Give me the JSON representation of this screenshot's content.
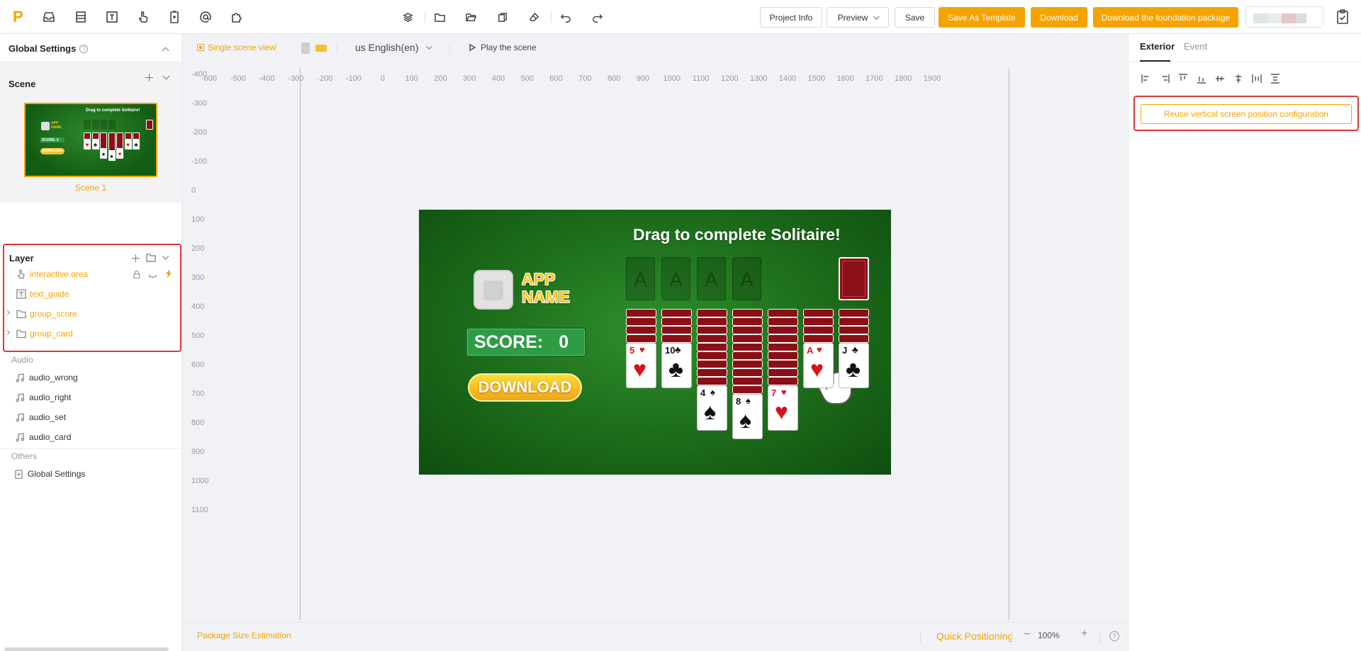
{
  "toolbar": {
    "left_icons": [
      "inbox-icon",
      "layout-icon",
      "text-icon",
      "hand-pointer-icon",
      "battery-icon",
      "at-sign-icon",
      "puzzle-icon"
    ],
    "project_info": "Project Info",
    "preview": "Preview",
    "save": "Save",
    "save_template": "Save As Template",
    "download": "Download",
    "download_foundation": "Download the foundation package",
    "accent": "#f5a300"
  },
  "left_panel": {
    "global_settings": "Global Settings",
    "help_mark": "?",
    "scene_title": "Scene",
    "scene_label": "Scene 1",
    "layer_title": "Layer",
    "layers": [
      {
        "label": "interactive area",
        "icon": "hand-pointer-icon"
      },
      {
        "label": "text_guide",
        "icon": "text-icon"
      },
      {
        "label": "group_score",
        "icon": "folder-icon"
      },
      {
        "label": "group_card",
        "icon": "folder-icon"
      }
    ],
    "audio_title": "Audio",
    "audio": [
      "audio_wrong",
      "audio_right",
      "audio_set",
      "audio_card"
    ],
    "others_title": "Others",
    "others": [
      "Global Settings"
    ]
  },
  "canvas": {
    "single_scene": "Single scene view",
    "language": "us English(en)",
    "play_scene": "Play the scene",
    "ruler_h": [
      "-600",
      "-500",
      "-400",
      "-300",
      "-200",
      "-100",
      "0",
      "100",
      "200",
      "300",
      "400",
      "500",
      "600",
      "700",
      "800",
      "900",
      "1000",
      "1100",
      "1200",
      "1300",
      "1400",
      "1500",
      "1600",
      "1700",
      "1800",
      "1900"
    ],
    "ruler_v": [
      "-400",
      "-300",
      "-200",
      "-100",
      "0",
      "100",
      "200",
      "300",
      "400",
      "500",
      "600",
      "700",
      "800",
      "900",
      "1000",
      "1100"
    ],
    "package_size": "Package Size Estimation",
    "quick_positioning": "Quick Positioning",
    "zoom": "100%",
    "zoom_minus": "−",
    "zoom_plus": "+",
    "help_mark": "?"
  },
  "stage": {
    "title": "Drag to complete Solitaire!",
    "app_name_1": "APP",
    "app_name_2": "NAME",
    "score_label": "SCORE:",
    "score_value": "0",
    "download": "DOWNLOAD",
    "foundation_letter": "A",
    "columns": [
      {
        "rank": "5",
        "suit": "♥",
        "color": "red",
        "backs": 4
      },
      {
        "rank": "10",
        "suit": "♣",
        "color": "blk",
        "backs": 4
      },
      {
        "rank": "4",
        "suit": "♠",
        "color": "blk",
        "backs": 9
      },
      {
        "rank": "8",
        "suit": "♠",
        "color": "blk",
        "backs": 10
      },
      {
        "rank": "7",
        "suit": "♥",
        "color": "red",
        "backs": 9
      },
      {
        "rank": "A",
        "suit": "♥",
        "color": "red",
        "backs": 4
      },
      {
        "rank": "J",
        "suit": "♣",
        "color": "blk",
        "backs": 4
      }
    ]
  },
  "right_panel": {
    "tab_exterior": "Exterior",
    "tab_event": "Event",
    "align_icons": [
      "align-left-icon",
      "align-right-icon",
      "align-top-icon",
      "align-bottom-icon",
      "align-vcenter-icon",
      "align-hcenter-icon",
      "distribute-h-icon",
      "distribute-v-icon"
    ],
    "reuse_button": "Reuse vertical screen position configuration"
  }
}
